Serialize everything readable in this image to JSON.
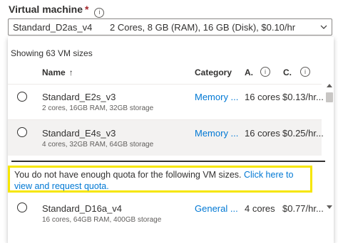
{
  "field": {
    "label": "Virtual machine",
    "required_mark": "*",
    "info_glyph": "i"
  },
  "dropdown": {
    "selected_name": "Standard_D2as_v4",
    "selected_specs": "2 Cores, 8 GB (RAM), 16 GB (Disk), $0.10/hr"
  },
  "panel": {
    "showing_text": "Showing 63 VM sizes",
    "columns": {
      "name": "Name",
      "sort_arrow": "↑",
      "category": "Category",
      "a": "A.",
      "c": "C."
    },
    "rows": [
      {
        "name": "Standard_E2s_v3",
        "details": "2 cores, 16GB RAM, 32GB storage",
        "category": "Memory ...",
        "cores": "16 cores",
        "cost": "$0.13/hr..."
      },
      {
        "name": "Standard_E4s_v3",
        "details": "4 cores, 32GB RAM, 64GB storage",
        "category": "Memory ...",
        "cores": "16 cores",
        "cost": "$0.25/hr..."
      },
      {
        "name": "Standard_D16a_v4",
        "details": "16 cores, 64GB RAM, 400GB storage",
        "category": "General ...",
        "cores": "4 cores",
        "cost": "$0.77/hr..."
      }
    ],
    "quota_message": "You do not have enough quota for the following VM sizes.",
    "quota_link": "Click here to view and request quota."
  },
  "colors": {
    "accent": "#0078d4",
    "highlight_border": "#f6e600",
    "selected_row_bg": "#f3f2f1"
  },
  "icons": [
    "info-icon",
    "chevron-down-icon",
    "sort-ascending-icon",
    "radio-button"
  ]
}
